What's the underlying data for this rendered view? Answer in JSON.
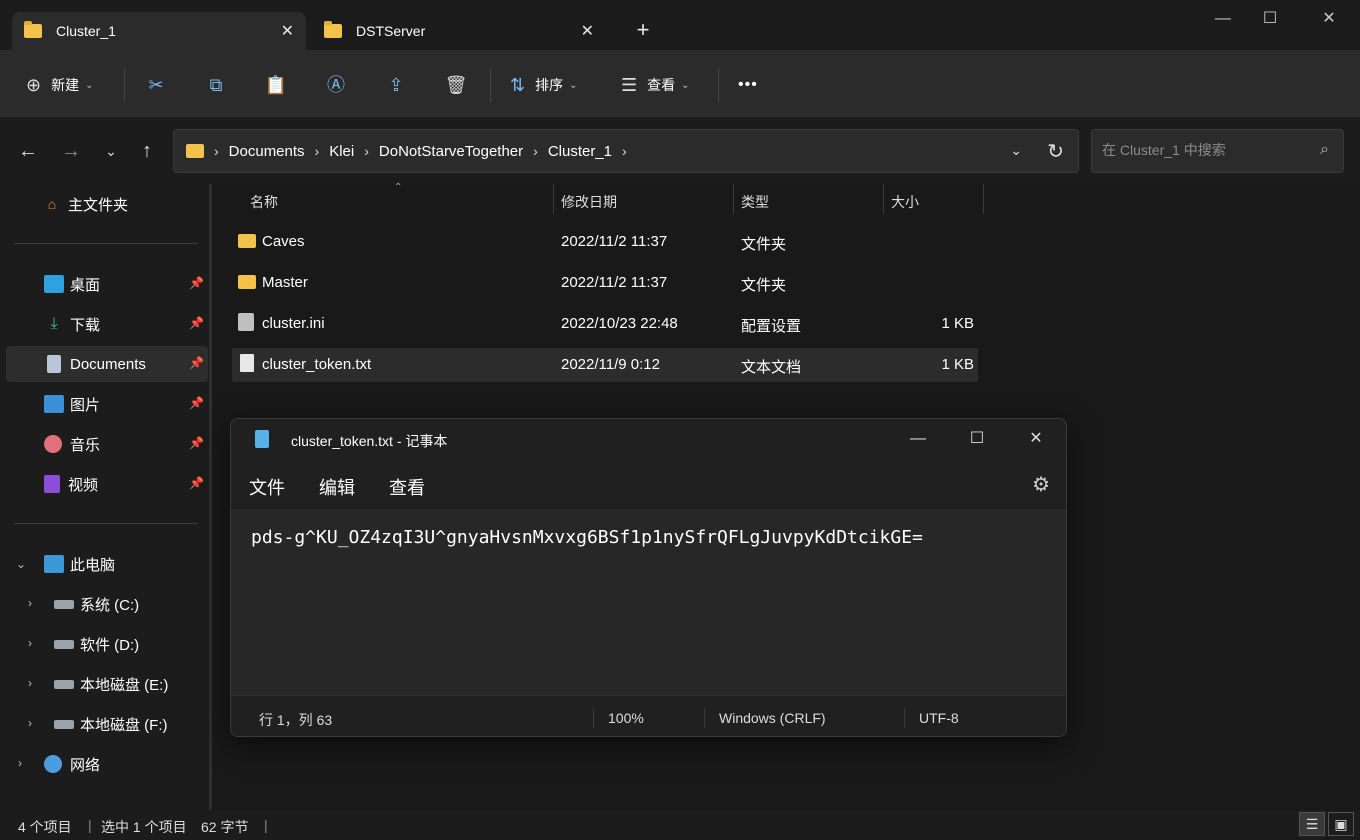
{
  "tabs": [
    {
      "label": "Cluster_1",
      "active": true
    },
    {
      "label": "DSTServer",
      "active": false
    }
  ],
  "toolbar": {
    "new_label": "新建",
    "sort_label": "排序",
    "view_label": "查看",
    "more_label": "•••"
  },
  "breadcrumb": [
    "Documents",
    "Klei",
    "DoNotStarveTogether",
    "Cluster_1"
  ],
  "search": {
    "placeholder": "在 Cluster_1 中搜索"
  },
  "sidebar": {
    "home": "主文件夹",
    "quick": [
      {
        "label": "桌面",
        "icon": "desktop-icon"
      },
      {
        "label": "下载",
        "icon": "download-icon"
      },
      {
        "label": "Documents",
        "icon": "documents-icon"
      },
      {
        "label": "图片",
        "icon": "pictures-icon"
      },
      {
        "label": "音乐",
        "icon": "music-icon"
      },
      {
        "label": "视频",
        "icon": "videos-icon"
      }
    ],
    "this_pc": "此电脑",
    "drives": [
      {
        "label": "系统 (C:)"
      },
      {
        "label": "软件 (D:)"
      },
      {
        "label": "本地磁盘 (E:)"
      },
      {
        "label": "本地磁盘 (F:)"
      }
    ],
    "network": "网络"
  },
  "columns": {
    "name": "名称",
    "modified": "修改日期",
    "type": "类型",
    "size": "大小"
  },
  "files": [
    {
      "name": "Caves",
      "modified": "2022/11/2 11:37",
      "type": "文件夹",
      "size": ""
    },
    {
      "name": "Master",
      "modified": "2022/11/2 11:37",
      "type": "文件夹",
      "size": ""
    },
    {
      "name": "cluster.ini",
      "modified": "2022/10/23 22:48",
      "type": "配置设置",
      "size": "1 KB"
    },
    {
      "name": "cluster_token.txt",
      "modified": "2022/11/9 0:12",
      "type": "文本文档",
      "size": "1 KB"
    }
  ],
  "status": {
    "count": "4 个项目",
    "selected": "选中 1 个项目",
    "bytes": "62 字节"
  },
  "notepad": {
    "title": "cluster_token.txt - 记事本",
    "menu": {
      "file": "文件",
      "edit": "编辑",
      "view": "查看"
    },
    "content": "pds-g^KU_OZ4zqI3U^gnyaHvsnMxvxg6BSf1p1nySfrQFLgJuvpyKdDtcikGE=",
    "status": {
      "position": "行 1，列 63",
      "zoom": "100%",
      "line_ending": "Windows (CRLF)",
      "encoding": "UTF-8"
    }
  },
  "colors": {
    "accent": "#7ab8ee",
    "folder": "#f3c24a",
    "background": "#1c1c1c"
  }
}
